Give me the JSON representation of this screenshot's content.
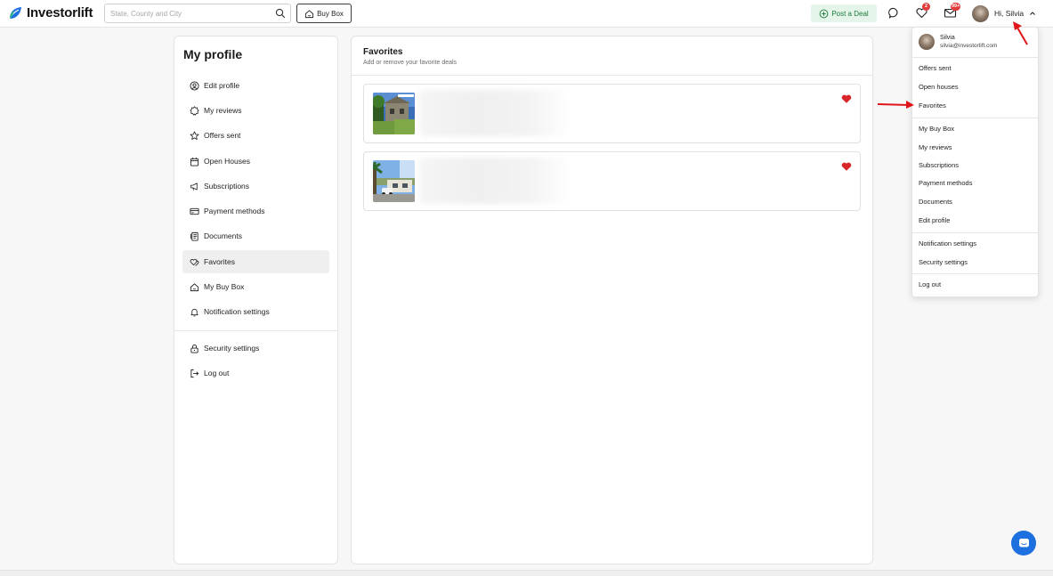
{
  "header": {
    "logo_text": "Investorlift",
    "search_placeholder": "State, County and City",
    "buy_box_label": "Buy Box",
    "post_deal_label": "Post a Deal",
    "favorites_badge": "2",
    "messages_badge": "99+",
    "greeting": "Hi, Silvia",
    "accent_color": "#1b7a3b"
  },
  "profile_nav": {
    "title": "My profile",
    "items": [
      {
        "label": "Edit profile",
        "icon": "user-circle-icon"
      },
      {
        "label": "My reviews",
        "icon": "badge-icon"
      },
      {
        "label": "Offers sent",
        "icon": "star-icon"
      },
      {
        "label": "Open Houses",
        "icon": "calendar-icon"
      },
      {
        "label": "Subscriptions",
        "icon": "megaphone-icon"
      },
      {
        "label": "Payment methods",
        "icon": "credit-card-icon"
      },
      {
        "label": "Documents",
        "icon": "document-icon"
      },
      {
        "label": "Favorites",
        "icon": "hearts-icon"
      },
      {
        "label": "My Buy Box",
        "icon": "house-icon"
      },
      {
        "label": "Notification settings",
        "icon": "bell-icon"
      },
      {
        "label": "Security settings",
        "icon": "lock-icon"
      },
      {
        "label": "Log out",
        "icon": "logout-icon"
      }
    ],
    "active": "Favorites"
  },
  "favorites": {
    "title": "Favorites",
    "subtitle": "Add or remove your favorite deals",
    "cards": [
      {
        "thumb": "house-photo-1",
        "favorited": true
      },
      {
        "thumb": "house-photo-2",
        "favorited": true
      }
    ],
    "heart_color": "#d8262b"
  },
  "dropdown": {
    "name": "Silvia",
    "email": "silvia@investorlift.com",
    "groups": [
      [
        "Offers sent",
        "Open houses",
        "Favorites"
      ],
      [
        "My Buy Box",
        "My reviews",
        "Subscriptions",
        "Payment methods",
        "Documents",
        "Edit profile"
      ],
      [
        "Notification settings",
        "Security settings"
      ],
      [
        "Log out"
      ]
    ]
  },
  "annotation_color": "#e0151a",
  "chat_color": "#1e6fe0"
}
